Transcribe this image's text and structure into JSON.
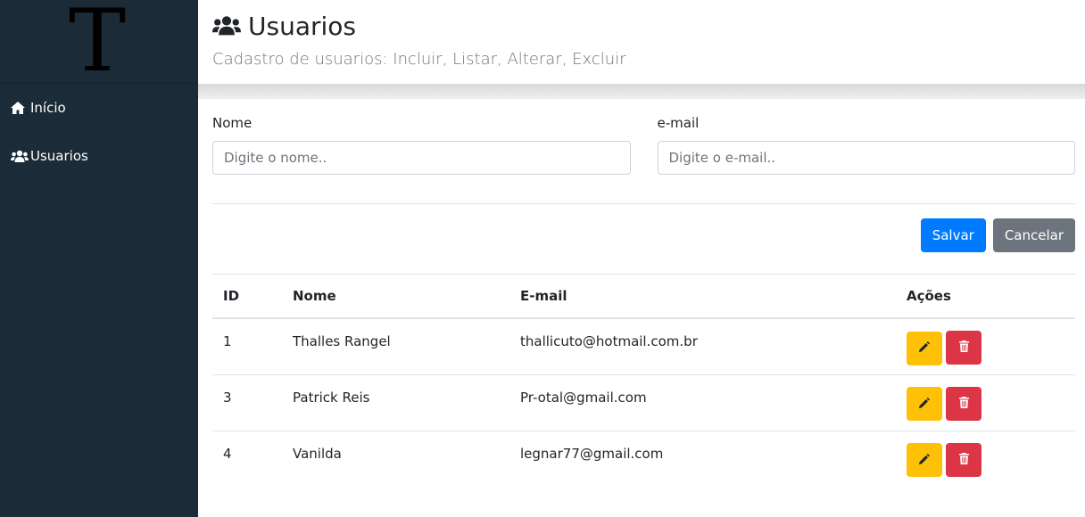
{
  "sidebar": {
    "logo_letter": "T",
    "items": [
      {
        "label": "Início",
        "icon": "home-icon"
      },
      {
        "label": "Usuarios",
        "icon": "users-icon"
      }
    ]
  },
  "header": {
    "title": "Usuarios",
    "title_icon": "users-icon",
    "subtitle": "Cadastro de usuarios: Incluir, Listar, Alterar, Excluir"
  },
  "form": {
    "nome_label": "Nome",
    "nome_placeholder": "Digite o nome..",
    "nome_value": "",
    "email_label": "e-mail",
    "email_placeholder": "Digite o e-mail..",
    "email_value": "",
    "save_label": "Salvar",
    "cancel_label": "Cancelar"
  },
  "table": {
    "columns": [
      "ID",
      "Nome",
      "E-mail",
      "Ações"
    ],
    "rows": [
      {
        "id": "1",
        "nome": "Thalles Rangel",
        "email": "thallicuto@hotmail.com.br"
      },
      {
        "id": "3",
        "nome": "Patrick Reis",
        "email": "Pr-otal@gmail.com"
      },
      {
        "id": "4",
        "nome": "Vanilda",
        "email": "legnar77@gmail.com"
      }
    ]
  },
  "colors": {
    "sidebar_bg": "#1b2b37",
    "primary": "#007bff",
    "secondary": "#6c757d",
    "warning": "#ffc107",
    "danger": "#dc3545"
  }
}
